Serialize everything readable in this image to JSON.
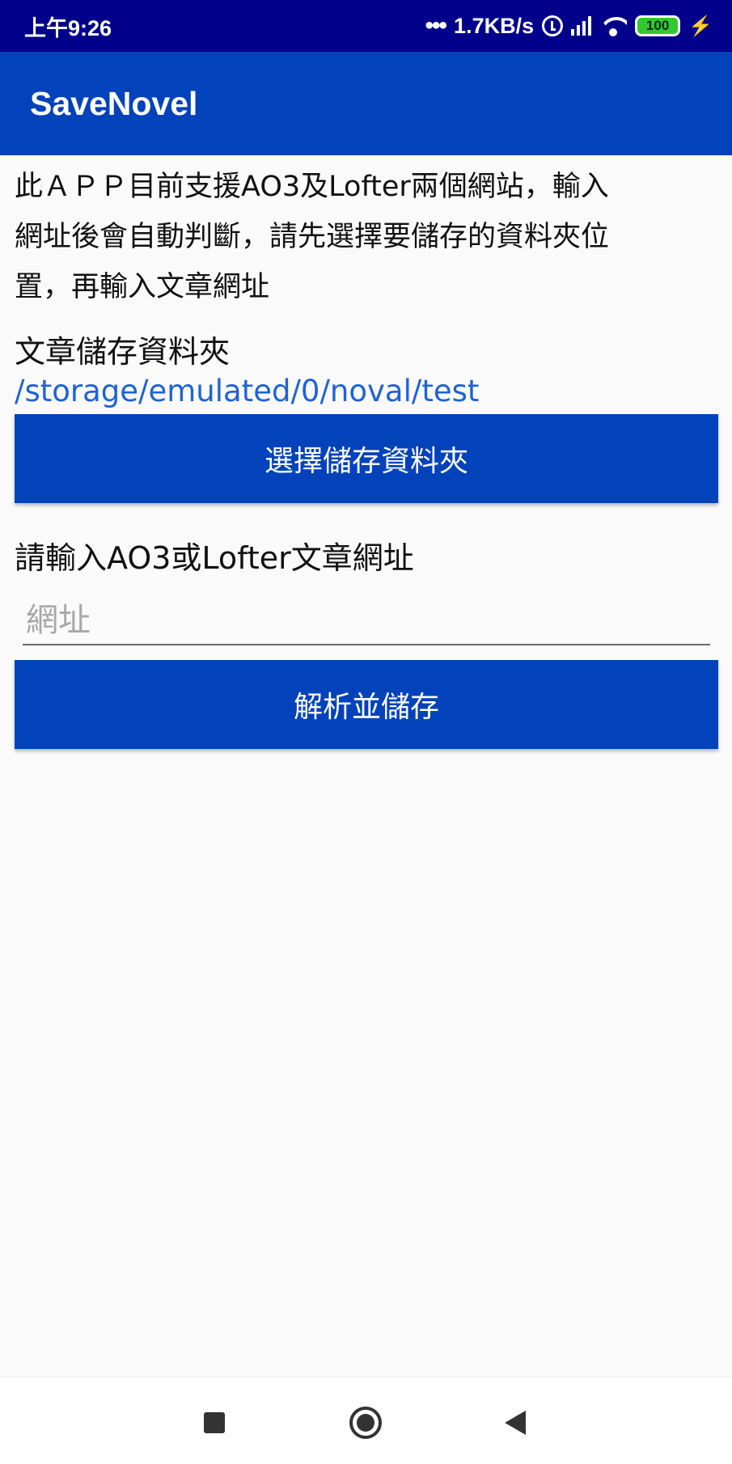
{
  "status_bar": {
    "time": "上午9:26",
    "dots": "•••",
    "network_speed": "1.7KB/s",
    "battery": "100",
    "icons": [
      "alarm-icon",
      "signal-icon",
      "wifi-icon",
      "battery-icon",
      "charging-bolt-icon"
    ]
  },
  "app_bar": {
    "title": "SaveNovel",
    "color": "#0243bb"
  },
  "main": {
    "intro_line1": "此ＡＰＰ目前支援AO3及Lofter兩個網站，輸入",
    "intro_line2": "網址後會自動判斷，請先選擇要儲存的資料夾位",
    "intro_line3": "置，再輸入文章網址",
    "folder_heading": "文章儲存資料夾",
    "folder_path": "/storage/emulated/0/noval/test",
    "select_folder_button": "選擇儲存資料夾",
    "url_heading": "請輸入AO3或Lofter文章網址",
    "url_input": {
      "value": "",
      "placeholder": "網址"
    },
    "parse_save_button": "解析並儲存"
  },
  "nav_bar": {
    "icons": [
      "recents-square-icon",
      "home-circle-icon",
      "back-triangle-icon"
    ]
  }
}
